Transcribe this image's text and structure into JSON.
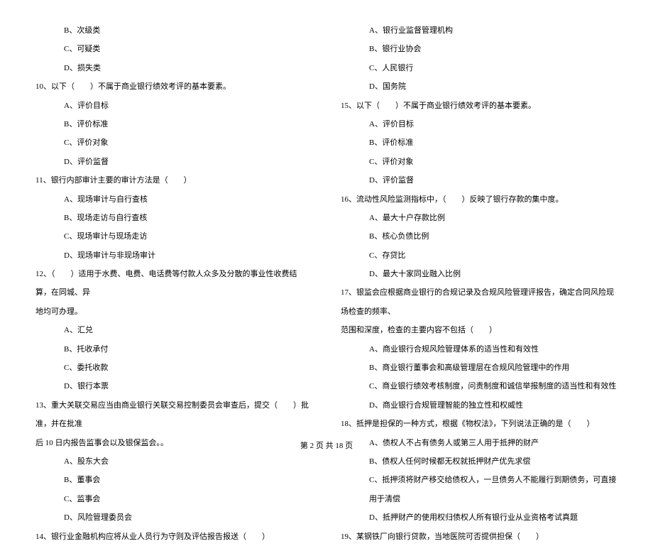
{
  "left_column": [
    {
      "text": "B、次级类",
      "indent": 1
    },
    {
      "text": "C、可疑类",
      "indent": 1
    },
    {
      "text": "D、损失类",
      "indent": 1
    },
    {
      "text": "10、以下（　　）不属于商业银行绩效考评的基本要素。",
      "indent": 0
    },
    {
      "text": "A、评价目标",
      "indent": 1
    },
    {
      "text": "B、评价标准",
      "indent": 1
    },
    {
      "text": "C、评价对象",
      "indent": 1
    },
    {
      "text": "D、评价监督",
      "indent": 1
    },
    {
      "text": "11、银行内部审计主要的审计方法是（　　）",
      "indent": 0
    },
    {
      "text": "A、现场审计与自行查核",
      "indent": 1
    },
    {
      "text": "B、现场走访与自行查核",
      "indent": 1
    },
    {
      "text": "C、现场审计与现场走访",
      "indent": 1
    },
    {
      "text": "D、现场审计与非现场审计",
      "indent": 1
    },
    {
      "text": "12、（　　）适用于水费、电费、电话费等付款人众多及分散的事业性收费结算，在同城、异",
      "indent": 0
    },
    {
      "text": "地均可办理。",
      "indent": 0
    },
    {
      "text": "A、汇兑",
      "indent": 1
    },
    {
      "text": "B、托收承付",
      "indent": 1
    },
    {
      "text": "C、委托收款",
      "indent": 1
    },
    {
      "text": "D、银行本票",
      "indent": 1
    },
    {
      "text": "13、重大关联交易应当由商业银行关联交易控制委员会审查后，提交（　　）批准，并在批准",
      "indent": 0
    },
    {
      "text": "后 10 日内报告监事会以及银保监会。。",
      "indent": 0
    },
    {
      "text": "A、股东大会",
      "indent": 1
    },
    {
      "text": "B、董事会",
      "indent": 1
    },
    {
      "text": "C、监事会",
      "indent": 1
    },
    {
      "text": "D、风险管理委员会",
      "indent": 1
    },
    {
      "text": "14、银行业金融机构应将从业人员行为守则及评估报告报送（　　）",
      "indent": 0
    }
  ],
  "right_column": [
    {
      "text": "A、银行业监督管理机构",
      "indent": 1
    },
    {
      "text": "B、银行业协会",
      "indent": 1
    },
    {
      "text": "C、人民银行",
      "indent": 1
    },
    {
      "text": "D、国务院",
      "indent": 1
    },
    {
      "text": "15、以下（　　）不属于商业银行绩效考评的基本要素。",
      "indent": 0
    },
    {
      "text": "A、评价目标",
      "indent": 1
    },
    {
      "text": "B、评价标准",
      "indent": 1
    },
    {
      "text": "C、评价对象",
      "indent": 1
    },
    {
      "text": "D、评价监督",
      "indent": 1
    },
    {
      "text": "16、流动性风险监测指标中，（　　）反映了银行存款的集中度。",
      "indent": 0
    },
    {
      "text": "A、最大十户存款比例",
      "indent": 1
    },
    {
      "text": "B、核心负债比例",
      "indent": 1
    },
    {
      "text": "C、存贷比",
      "indent": 1
    },
    {
      "text": "D、最大十家同业融入比例",
      "indent": 1
    },
    {
      "text": "17、银监会应根据商业银行的合规记录及合规风险管理评报告，确定合同风险现场检查的频率、",
      "indent": 0
    },
    {
      "text": "范围和深度，检查的主要内容不包括（　　）",
      "indent": 0
    },
    {
      "text": "A、商业银行合规风险管理体系的适当性和有效性",
      "indent": 1
    },
    {
      "text": "B、商业银行董事会和高级管理层在合规风险管理中的作用",
      "indent": 1
    },
    {
      "text": "C、商业银行绩效考核制度，问责制度和诚信举报制度的适当性和有效性",
      "indent": 1
    },
    {
      "text": "D、商业银行合规管理智能的独立性和权威性",
      "indent": 1
    },
    {
      "text": "18、抵押是担保的一种方式，根据《物权法》，下列说法正确的是（　　）",
      "indent": 0
    },
    {
      "text": "A、债权人不占有债务人或第三人用于抵押的财产",
      "indent": 1
    },
    {
      "text": "B、债权人任何时候都无权就抵押财产优先求偿",
      "indent": 1
    },
    {
      "text": "C、抵押须将财产移交给债权人，一旦债务人不能履行到期债务，可直接用于清偿",
      "indent": 1
    },
    {
      "text": "D、抵押财产的使用权归债权人所有银行业从业资格考试真题",
      "indent": 1
    },
    {
      "text": "19、某钢铁厂向银行贷款，当地医院可否提供担保（　　）",
      "indent": 0
    }
  ],
  "footer": "第 2 页 共 18 页"
}
